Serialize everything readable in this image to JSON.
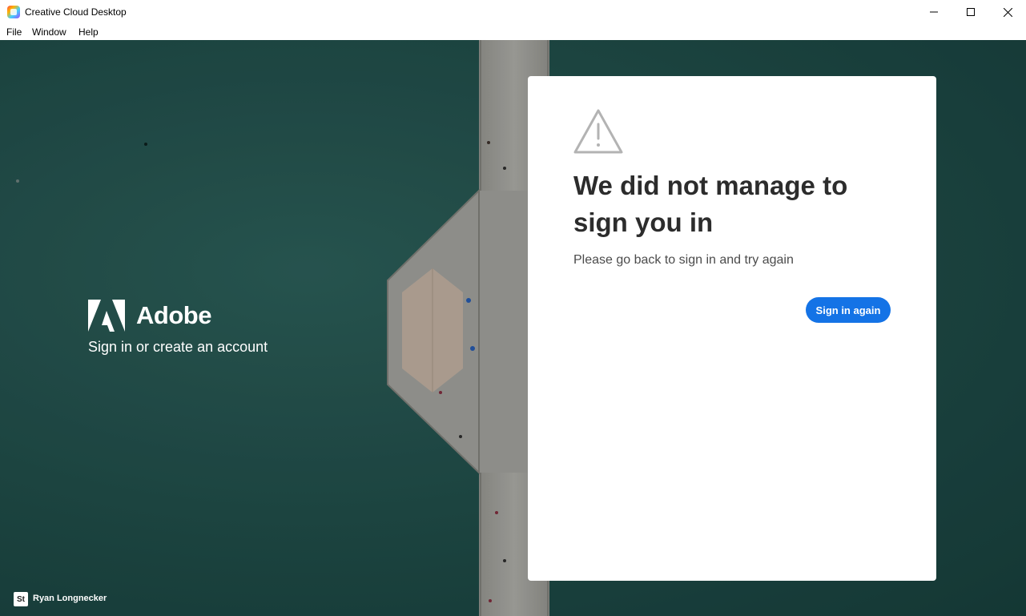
{
  "window": {
    "title": "Creative Cloud Desktop",
    "controls": {
      "minimize_icon": "minimize-icon",
      "maximize_icon": "maximize-icon",
      "close_icon": "close-icon"
    }
  },
  "menu": {
    "items": [
      "File",
      "Window",
      "Help"
    ]
  },
  "brand": {
    "wordmark": "Adobe",
    "subtitle": "Sign in or create an account"
  },
  "card": {
    "icon": "warning-icon",
    "title": "We did not manage to sign you in",
    "description": "Please go back to sign in and try again",
    "button_label": "Sign in again"
  },
  "user": {
    "badge": "St",
    "name": "Ryan Longnecker"
  },
  "colors": {
    "accent": "#1473e6",
    "title_text": "#2c2c2c",
    "background_water": "#1f4a46"
  }
}
